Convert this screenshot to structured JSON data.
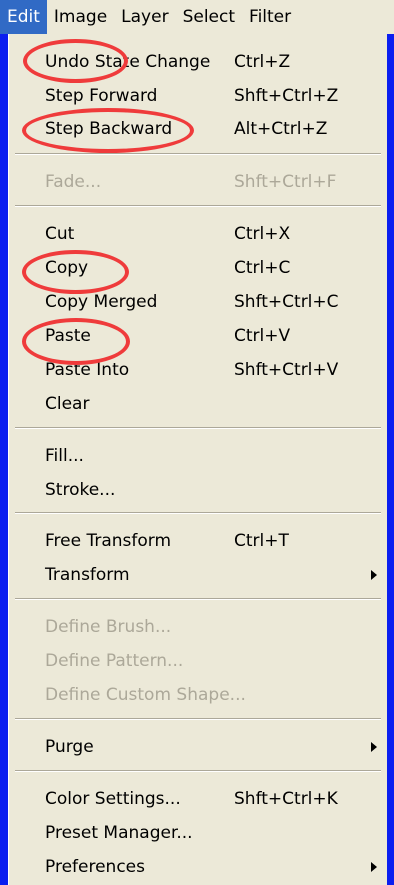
{
  "menubar": {
    "items": [
      {
        "label": "Edit",
        "active": true
      },
      {
        "label": "Image"
      },
      {
        "label": "Layer"
      },
      {
        "label": "Select"
      },
      {
        "label": "Filter"
      }
    ]
  },
  "edit_menu": {
    "items": [
      {
        "label": "Undo State Change",
        "shortcut": "Ctrl+Z"
      },
      {
        "label": "Step Forward",
        "shortcut": "Shft+Ctrl+Z"
      },
      {
        "label": "Step Backward",
        "shortcut": "Alt+Ctrl+Z"
      },
      {
        "label": "Fade...",
        "shortcut": "Shft+Ctrl+F",
        "disabled": true
      },
      {
        "label": "Cut",
        "shortcut": "Ctrl+X"
      },
      {
        "label": "Copy",
        "shortcut": "Ctrl+C"
      },
      {
        "label": "Copy Merged",
        "shortcut": "Shft+Ctrl+C"
      },
      {
        "label": "Paste",
        "shortcut": "Ctrl+V"
      },
      {
        "label": "Paste Into",
        "shortcut": "Shft+Ctrl+V"
      },
      {
        "label": "Clear"
      },
      {
        "label": "Fill..."
      },
      {
        "label": "Stroke..."
      },
      {
        "label": "Free Transform",
        "shortcut": "Ctrl+T"
      },
      {
        "label": "Transform",
        "submenu": true
      },
      {
        "label": "Define Brush...",
        "disabled": true
      },
      {
        "label": "Define Pattern...",
        "disabled": true
      },
      {
        "label": "Define Custom Shape...",
        "disabled": true
      },
      {
        "label": "Purge",
        "submenu": true
      },
      {
        "label": "Color Settings...",
        "shortcut": "Shft+Ctrl+K"
      },
      {
        "label": "Preset Manager..."
      },
      {
        "label": "Preferences",
        "submenu": true
      }
    ]
  },
  "highlights": [
    "Undo State Change",
    "Step Backward",
    "Copy",
    "Paste"
  ],
  "colors": {
    "frame": "#0a1ef0",
    "menu_bg": "#ece9d8",
    "active": "#316ac5",
    "highlight": "#ef3b3b",
    "disabled": "#aca899"
  }
}
